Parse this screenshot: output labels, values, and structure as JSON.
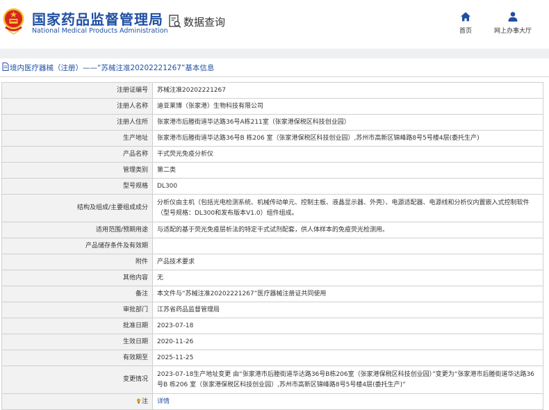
{
  "header": {
    "org_name_cn": "国家药品监督管理局",
    "org_name_en": "National Medical Products Administration",
    "query_title": "数据查询",
    "nav": [
      {
        "label": "首页",
        "icon": "home-icon"
      },
      {
        "label": "网上办事大厅",
        "icon": "user-icon"
      }
    ]
  },
  "page_title": "境内医疗器械（注册）——“苏械注准20202221267”基本信息",
  "rows": [
    {
      "label": "注册证编号",
      "value": "苏械注准20202221267"
    },
    {
      "label": "注册人名称",
      "value": "迪亚莱博（张家港）生物科技有限公司"
    },
    {
      "label": "注册人住所",
      "value": "张家港市后塍街道华达路36号A栋211室（张家港保税区科技创业园）"
    },
    {
      "label": "生产地址",
      "value": "张家港市后塍街道华达路36号B 栋206 室（张家港保税区科技创业园）,苏州市高新区锦峰路8号5号楼4层(委托生产)"
    },
    {
      "label": "产品名称",
      "value": "干式荧光免疫分析仪"
    },
    {
      "label": "管理类别",
      "value": "第二类"
    },
    {
      "label": "型号规格",
      "value": "DL300"
    },
    {
      "label": "结构及组成/主要组成成分",
      "value": "分析仪由主机（包括光电检测系统、机械传动单元、控制主板、液晶显示器、外壳）、电源适配器、电源线和分析仪内置嵌入式控制软件（型号规格：DL300和发布版本V1.0）组件组成。"
    },
    {
      "label": "适用范围/预期用途",
      "value": "与适配的基于荧光免疫层析法的特定干式试剂配套，供人体样本的免疫荧光检测用。"
    },
    {
      "label": "产品储存条件及有效期",
      "value": ""
    },
    {
      "label": "附件",
      "value": "产品技术要求"
    },
    {
      "label": "其他内容",
      "value": "无"
    },
    {
      "label": "备注",
      "value": "本文件与“苏械注准20202221267”医疗器械注册证共同使用"
    },
    {
      "label": "审批部门",
      "value": "江苏省药品监督管理局"
    },
    {
      "label": "批准日期",
      "value": "2023-07-18"
    },
    {
      "label": "生效日期",
      "value": "2020-11-26"
    },
    {
      "label": "有效期至",
      "value": "2025-11-25"
    },
    {
      "label": "变更情况",
      "value": "2023-07-18生产地址变更 由“张家港市后塍街道华达路36号B栋206室（张家港保税区科技创业园）”变更为“张家港市后塍街道华达路36号B 栋206 室（张家港保税区科技创业园）,苏州市高新区锦峰路8号5号楼4层(委托生产)”"
    }
  ],
  "note_row": {
    "label": "注",
    "value": "详情"
  },
  "colors": {
    "brand_blue": "#1f4fa3",
    "label_bg": "#f2f2f2",
    "border": "#cfcfcf",
    "emblem_red": "#d8261e",
    "emblem_gold": "#f2c230"
  }
}
